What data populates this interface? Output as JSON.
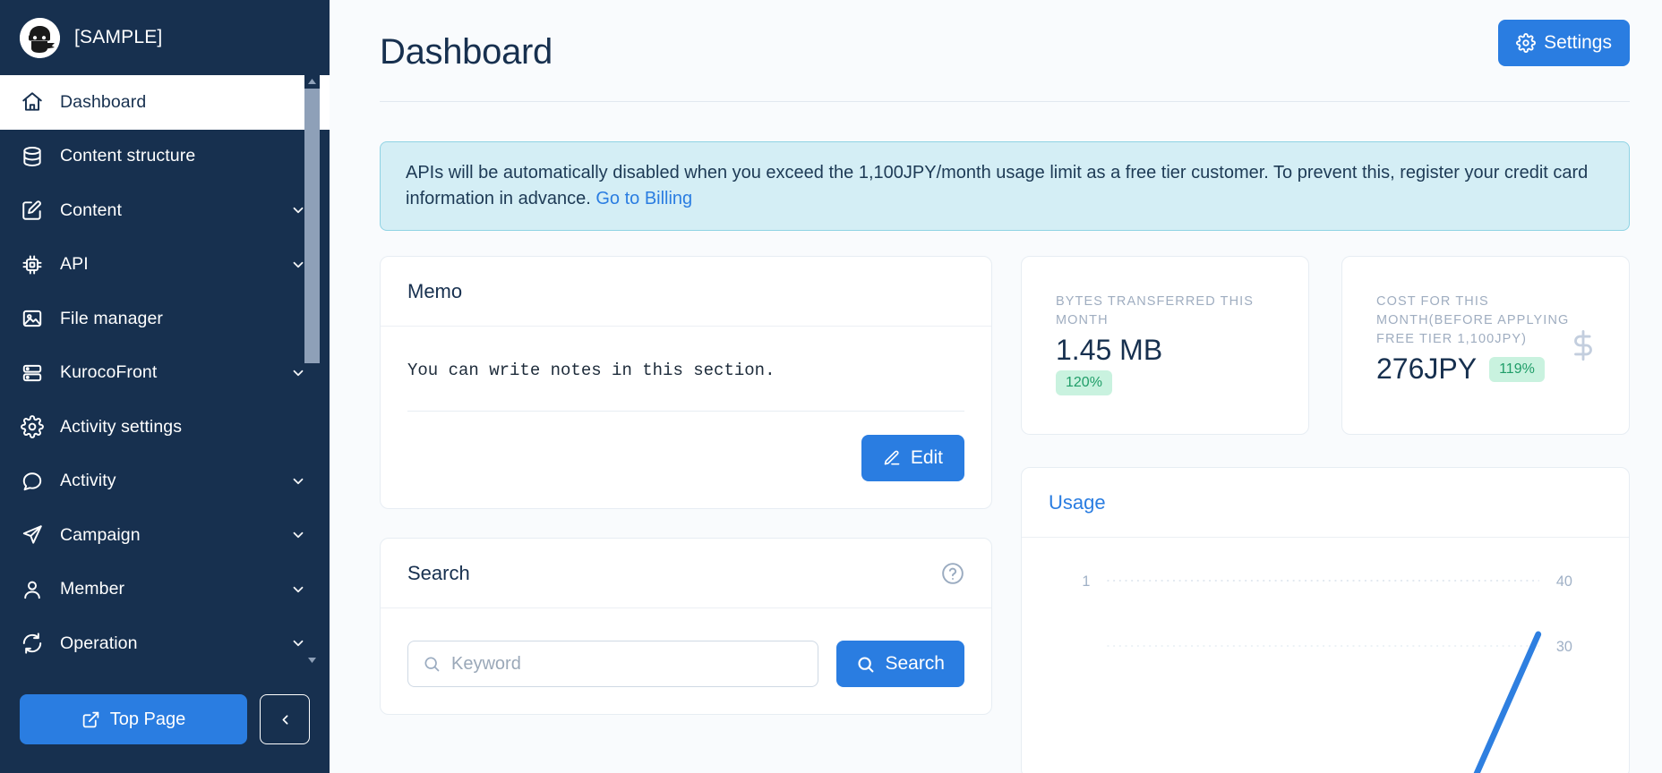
{
  "sidebar": {
    "brand": {
      "name": "[SAMPLE]",
      "logo_icon": "ninja-logo-icon"
    },
    "items": [
      {
        "label": "Dashboard",
        "icon": "home-icon",
        "active": true,
        "expandable": false
      },
      {
        "label": "Content structure",
        "icon": "database-icon",
        "active": false,
        "expandable": false
      },
      {
        "label": "Content",
        "icon": "edit-square-icon",
        "active": false,
        "expandable": true
      },
      {
        "label": "API",
        "icon": "chip-icon",
        "active": false,
        "expandable": true
      },
      {
        "label": "File manager",
        "icon": "image-icon",
        "active": false,
        "expandable": false
      },
      {
        "label": "KurocoFront",
        "icon": "server-icon",
        "active": false,
        "expandable": true
      },
      {
        "label": "Activity settings",
        "icon": "gear-icon",
        "active": false,
        "expandable": false
      },
      {
        "label": "Activity",
        "icon": "chat-bubble-icon",
        "active": false,
        "expandable": true
      },
      {
        "label": "Campaign",
        "icon": "paper-plane-icon",
        "active": false,
        "expandable": true
      },
      {
        "label": "Member",
        "icon": "person-icon",
        "active": false,
        "expandable": true
      },
      {
        "label": "Operation",
        "icon": "refresh-icon",
        "active": false,
        "expandable": true
      }
    ],
    "top_page_label": "Top Page",
    "top_page_icon": "external-link-icon",
    "collapse_icon": "chevron-left-icon"
  },
  "header": {
    "title": "Dashboard",
    "settings_label": "Settings",
    "settings_icon": "gear-icon"
  },
  "alert": {
    "text_before_link": "APIs will be automatically disabled when you exceed the 1,100JPY/month usage limit as a free tier customer. To prevent this, register your credit card information in advance. ",
    "link_label": "Go to Billing"
  },
  "memo": {
    "title": "Memo",
    "body": "You can write notes in this section.",
    "edit_label": "Edit",
    "edit_icon": "pencil-icon"
  },
  "search": {
    "title": "Search",
    "help_icon": "question-circle-icon",
    "input_icon": "search-icon",
    "placeholder": "Keyword",
    "value": "",
    "button_label": "Search",
    "button_icon": "search-icon"
  },
  "stats": [
    {
      "label": "BYTES TRANSFERRED THIS MONTH",
      "value": "1.45 MB",
      "badge": "120%",
      "icon": ""
    },
    {
      "label": "COST FOR THIS MONTH(BEFORE APPLYING FREE TIER 1,100JPY)",
      "value": "276JPY",
      "badge": "119%",
      "icon": "dollar-icon"
    }
  ],
  "usage": {
    "title": "Usage"
  },
  "colors": {
    "sidebar_bg": "#17304f",
    "accent_blue": "#2a7de1",
    "alert_bg": "#d4eef5",
    "alert_border": "#8fd3e4",
    "badge_bg": "#c9f2df",
    "badge_text": "#1f9d68",
    "chart_line": "#2e7fe0"
  },
  "chart_data": {
    "type": "line",
    "title": "Usage",
    "xlabel": "",
    "ylabel": "",
    "left_axis_ticks": [
      "1"
    ],
    "right_axis_ticks": [
      "40",
      "30"
    ],
    "ylim_right": [
      0,
      40
    ],
    "grid": true,
    "grid_style": "dotted",
    "legend": "none",
    "series": [
      {
        "name": "usage",
        "color": "#2e7fe0",
        "x": [
          0,
          1
        ],
        "values": [
          0,
          32
        ]
      }
    ]
  }
}
